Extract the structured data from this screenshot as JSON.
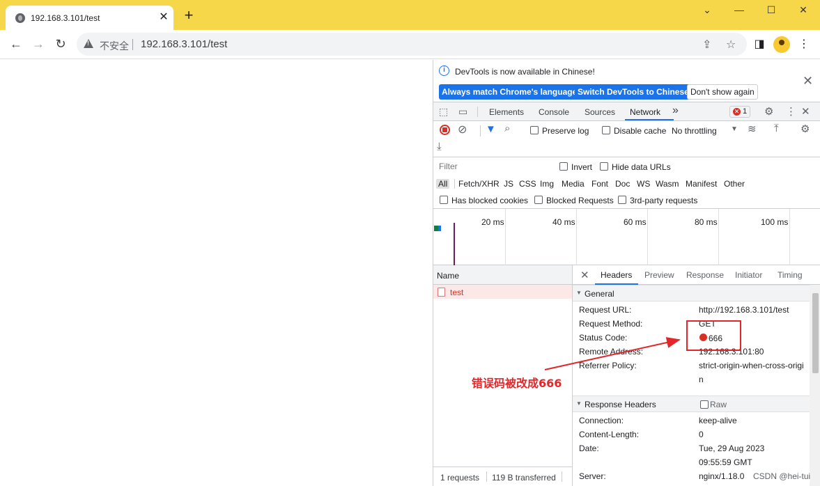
{
  "browser": {
    "tab_title": "192.168.3.101/test",
    "tab_close": "✕",
    "new_tab": "+",
    "window_controls": [
      "⌄",
      "—",
      "☐",
      "✕"
    ],
    "insecure_label": "不安全",
    "url": "192.168.3.101/test",
    "icons": [
      "back-icon",
      "forward-icon",
      "reload-icon",
      "warning-icon",
      "share-icon",
      "star-icon",
      "sidepanel-icon",
      "profile-icon",
      "menu-icon"
    ]
  },
  "devtools": {
    "info_message": "DevTools is now available in Chinese!",
    "btn_match": "Always match Chrome's language",
    "btn_switch": "Switch DevTools to Chinese",
    "btn_dont_show": "Don't show again",
    "tabs": [
      "Elements",
      "Console",
      "Sources",
      "Network"
    ],
    "more_tabs": "»",
    "error_count": "1",
    "preserve_log": "Preserve log",
    "disable_cache": "Disable cache",
    "throttling": "No throttling",
    "filter_placeholder": "Filter",
    "invert": "Invert",
    "hide_data_urls": "Hide data URLs",
    "filter_types": [
      "All",
      "Fetch/XHR",
      "JS",
      "CSS",
      "Img",
      "Media",
      "Font",
      "Doc",
      "WS",
      "Wasm",
      "Manifest",
      "Other"
    ],
    "has_blocked_cookies": "Has blocked cookies",
    "blocked_requests": "Blocked Requests",
    "third_party": "3rd-party requests",
    "timeline_labels": [
      "20 ms",
      "40 ms",
      "60 ms",
      "80 ms",
      "100 ms"
    ],
    "name_header": "Name",
    "request_name": "test",
    "footer_requests": "1 requests",
    "footer_transferred": "119 B transferred",
    "detail_tabs": [
      "Headers",
      "Preview",
      "Response",
      "Initiator",
      "Timing"
    ],
    "general_title": "General",
    "general": {
      "request_url_k": "Request URL:",
      "request_url_v": "http://192.168.3.101/test",
      "method_k": "Request Method:",
      "method_v": "GET",
      "status_k": "Status Code:",
      "status_v": "666",
      "remote_k": "Remote Address:",
      "remote_v": "192.168.3.101:80",
      "referrer_k": "Referrer Policy:",
      "referrer_v1": "strict-origin-when-cross-origi",
      "referrer_v2": "n"
    },
    "response_headers_title": "Response Headers",
    "raw": "Raw",
    "response": {
      "connection_k": "Connection:",
      "connection_v": "keep-alive",
      "content_length_k": "Content-Length:",
      "content_length_v": "0",
      "date_k": "Date:",
      "date_v1": "Tue, 29 Aug 2023",
      "date_v2": "09:55:59 GMT",
      "server_k": "Server:",
      "server_v": "nginx/1.18.0"
    }
  },
  "annotation": {
    "text": "错误码被改成666",
    "color": "#e3262a"
  },
  "watermark": "CSDN @hei-tui"
}
